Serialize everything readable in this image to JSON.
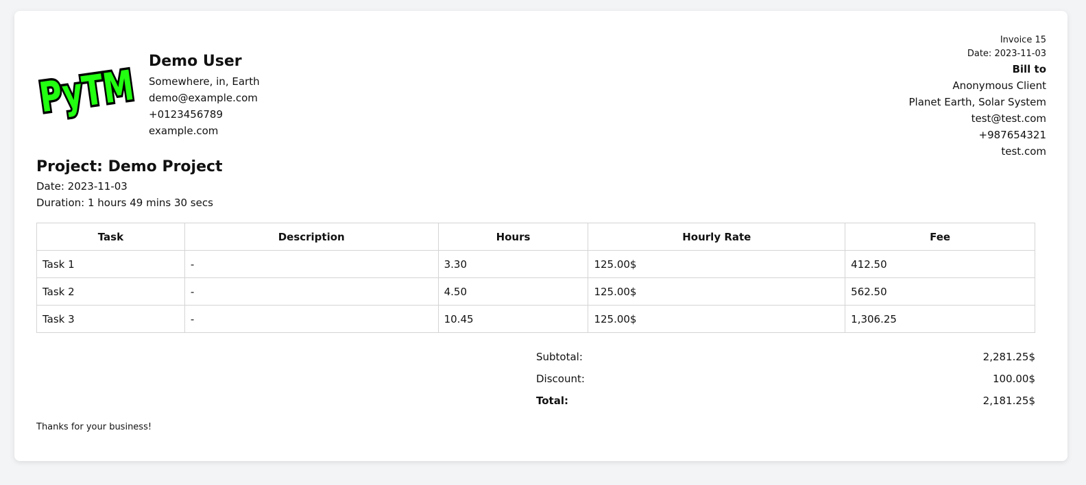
{
  "logo": {
    "text": "PyTM",
    "fill": "#22ff11",
    "outline": "#000000"
  },
  "sender": {
    "name": "Demo User",
    "address": "Somewhere, in, Earth",
    "email": "demo@example.com",
    "phone": "+0123456789",
    "website": "example.com"
  },
  "invoice": {
    "number_label": "Invoice 15",
    "date_label": "Date: 2023-11-03",
    "bill_to_label": "Bill to",
    "client_name": "Anonymous Client",
    "client_address": "Planet Earth, Solar System",
    "client_email": "test@test.com",
    "client_phone": "+987654321",
    "client_website": "test.com"
  },
  "project": {
    "title": "Project: Demo Project",
    "date_label": "Date: 2023-11-03",
    "duration_label": "Duration: 1 hours 49 mins 30 secs"
  },
  "table": {
    "headers": [
      "Task",
      "Description",
      "Hours",
      "Hourly Rate",
      "Fee"
    ],
    "rows": [
      [
        "Task 1",
        "-",
        "3.30",
        "125.00$",
        "412.50"
      ],
      [
        "Task 2",
        "-",
        "4.50",
        "125.00$",
        "562.50"
      ],
      [
        "Task 3",
        "-",
        "10.45",
        "125.00$",
        "1,306.25"
      ]
    ]
  },
  "totals": {
    "subtotal_label": "Subtotal:",
    "subtotal_value": "2,281.25$",
    "discount_label": "Discount:",
    "discount_value": "100.00$",
    "total_label": "Total:",
    "total_value": "2,181.25$"
  },
  "footer": {
    "thanks": "Thanks for your business!"
  }
}
